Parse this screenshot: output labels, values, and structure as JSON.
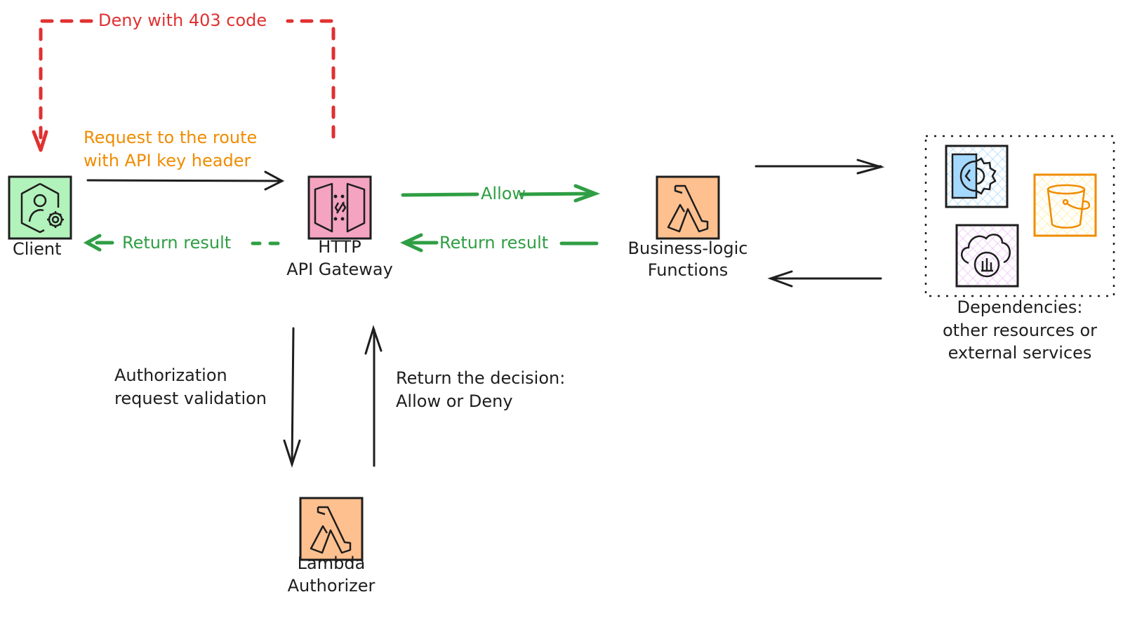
{
  "nodes": {
    "client": {
      "label": "Client",
      "fill": "#b2f2bb",
      "icon": "user-gear-icon"
    },
    "gateway": {
      "label_line1": "HTTP",
      "label_line2": "API Gateway",
      "fill": "#f4a4c0",
      "icon": "api-gateway-icon"
    },
    "functions": {
      "label_line1": "Business-logic",
      "label_line2": "Functions",
      "fill": "#ffc08f",
      "icon": "lambda-icon"
    },
    "authorizer": {
      "label_line1": "Lambda",
      "label_line2": "Authorizer",
      "fill": "#ffc08f",
      "icon": "lambda-icon"
    },
    "dependencies": {
      "label_line1": "Dependencies:",
      "label_line2": "other resources or",
      "label_line3": "external services",
      "items": [
        {
          "icon": "config-gear-icon",
          "fill": "#a5d8ff",
          "stroke": "#1e1e1e"
        },
        {
          "icon": "bucket-icon",
          "fill": "#ffec99",
          "stroke": "#f08c00"
        },
        {
          "icon": "cloud-analytics-icon",
          "fill": "#eebefa",
          "stroke": "#1e1e1e"
        }
      ]
    }
  },
  "edges": {
    "deny": {
      "label": "Deny with 403 code",
      "color": "#e03131"
    },
    "request": {
      "label_line1": "Request to the route",
      "label_line2": "with API key header",
      "color": "#f08c00"
    },
    "return_client": {
      "label": "Return result",
      "color": "#2f9e44"
    },
    "allow": {
      "label": "Allow",
      "color": "#2f9e44"
    },
    "return_gateway": {
      "label": "Return result",
      "color": "#2f9e44"
    },
    "auth_request": {
      "label_line1": "Authorization",
      "label_line2": "request validation"
    },
    "decision": {
      "label_line1": "Return the decision:",
      "label_line2": "Allow or Deny"
    }
  }
}
